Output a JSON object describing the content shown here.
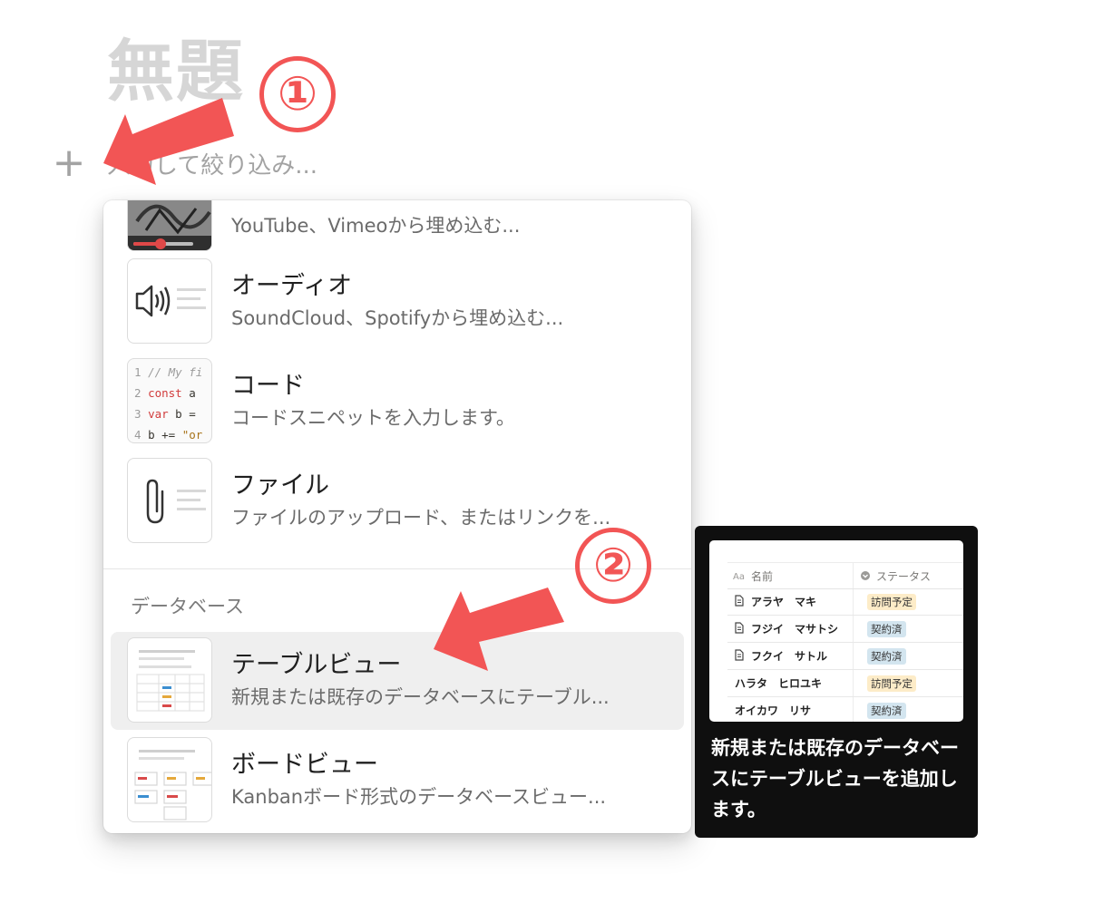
{
  "page": {
    "title": "無題"
  },
  "search": {
    "placeholder": "入力して絞り込み..."
  },
  "menu": {
    "items": [
      {
        "id": "video",
        "title": "",
        "desc": "YouTube、Vimeoから埋め込む..."
      },
      {
        "id": "audio",
        "title": "オーディオ",
        "desc": "SoundCloud、Spotifyから埋め込む..."
      },
      {
        "id": "code",
        "title": "コード",
        "desc": "コードスニペットを入力します。"
      },
      {
        "id": "file",
        "title": "ファイル",
        "desc": "ファイルのアップロード、またはリンクを..."
      }
    ],
    "section": "データベース",
    "db_items": [
      {
        "id": "table",
        "title": "テーブルビュー",
        "desc": "新規または既存のデータベースにテーブル..."
      },
      {
        "id": "board",
        "title": "ボードビュー",
        "desc": "Kanbanボード形式のデータベースビュー..."
      }
    ],
    "code_thumb": {
      "lines": [
        {
          "n": "1",
          "code": "// My fi"
        },
        {
          "n": "2",
          "kw": "const",
          "code": " a"
        },
        {
          "n": "3",
          "kw": "var",
          "code": " b ="
        },
        {
          "n": "4",
          "code": "b += ",
          "str": "\"or"
        }
      ]
    }
  },
  "tooltip": {
    "preview": {
      "col_name": "名前",
      "col_status": "ステータス",
      "rows": [
        {
          "name": "アラヤ　マキ",
          "status": "訪問予定"
        },
        {
          "name": "フジイ　マサトシ",
          "status": "契約済"
        },
        {
          "name": "フクイ　サトル",
          "status": "契約済"
        },
        {
          "name": "ハラタ　ヒロユキ",
          "status": "訪問予定"
        },
        {
          "name": "オイカワ　リサ",
          "status": "契約済"
        }
      ]
    },
    "text": "新規または既存のデータベースにテーブルビューを追加します。"
  },
  "annotations": {
    "one": "①",
    "two": "②"
  },
  "colors": {
    "annotation": "#f25555",
    "status_visit": "#fdecc8",
    "status_contract": "#d3e5ef",
    "active_bg": "#efefef",
    "tooltip_bg": "#0f0f0f"
  }
}
